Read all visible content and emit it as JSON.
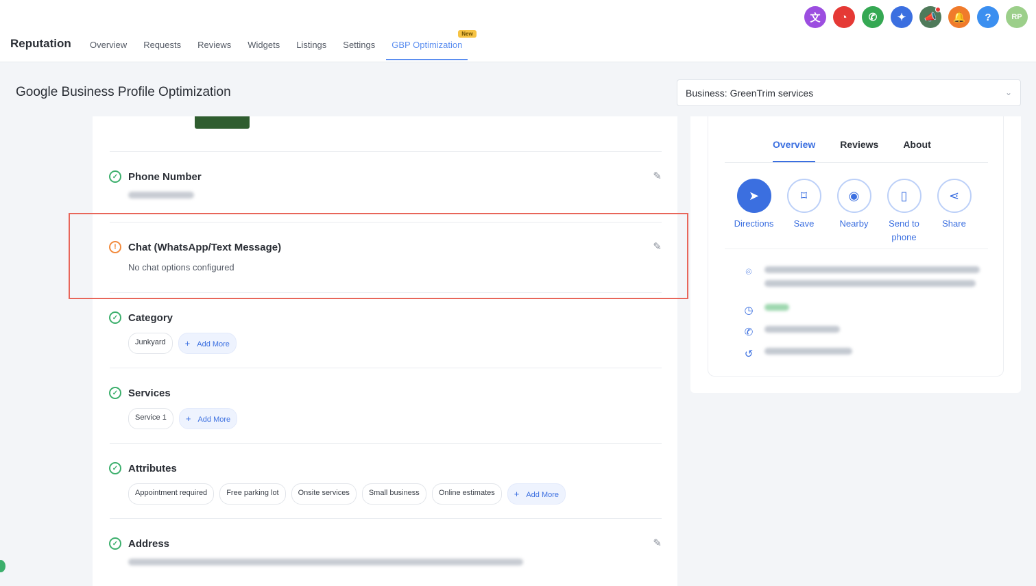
{
  "app": {
    "brand": "Reputation",
    "nav": [
      {
        "label": "Overview"
      },
      {
        "label": "Requests"
      },
      {
        "label": "Reviews"
      },
      {
        "label": "Widgets"
      },
      {
        "label": "Listings"
      },
      {
        "label": "Settings"
      },
      {
        "label": "GBP Optimization",
        "badge": "New",
        "active": true
      }
    ],
    "top_icons": [
      {
        "name": "translate-icon",
        "glyph": "文",
        "color": "#9c4ee0"
      },
      {
        "name": "speedometer-icon",
        "glyph": "◔",
        "color": "#e53935"
      },
      {
        "name": "phone-icon",
        "glyph": "✆",
        "color": "#35a853"
      },
      {
        "name": "magic-wand-icon",
        "glyph": "✦",
        "color": "#3b6fe0"
      },
      {
        "name": "megaphone-icon",
        "glyph": "📣",
        "color": "#4f7a5a",
        "dot": true
      },
      {
        "name": "bell-icon",
        "glyph": "🔔",
        "color": "#f07b2b"
      },
      {
        "name": "help-icon",
        "glyph": "?",
        "color": "#3b8ff0"
      },
      {
        "name": "user-avatar-icon",
        "glyph": "RP",
        "color": "#9ccf8a"
      }
    ]
  },
  "page": {
    "title": "Google Business Profile Optimization",
    "business_select": "Business: GreenTrim services"
  },
  "sections": {
    "phone": {
      "title": "Phone Number"
    },
    "chat": {
      "title": "Chat (WhatsApp/Text Message)",
      "subtitle": "No chat options configured"
    },
    "category": {
      "title": "Category",
      "chips": [
        "Junkyard"
      ],
      "add_label": "Add More"
    },
    "services": {
      "title": "Services",
      "chips": [
        "Service 1"
      ],
      "add_label": "Add More"
    },
    "attributes": {
      "title": "Attributes",
      "chips": [
        "Appointment required",
        "Free parking lot",
        "Onsite services",
        "Small business",
        "Online estimates"
      ],
      "add_label": "Add More"
    },
    "address": {
      "title": "Address"
    }
  },
  "preview": {
    "tabs": [
      "Overview",
      "Reviews",
      "About"
    ],
    "actions": [
      {
        "label": "Directions",
        "icon": "directions-icon",
        "glyph": "➤"
      },
      {
        "label": "Save",
        "icon": "bookmark-icon",
        "glyph": "⌑"
      },
      {
        "label": "Nearby",
        "icon": "nearby-icon",
        "glyph": "◉"
      },
      {
        "label": "Send to phone",
        "icon": "send-to-phone-icon",
        "glyph": "▯"
      },
      {
        "label": "Share",
        "icon": "share-icon",
        "glyph": "⋖"
      }
    ]
  },
  "colors": {
    "accent": "#3b6fe0",
    "success": "#3caf6c",
    "warning": "#f28a3c",
    "highlight_border": "#e8665a"
  }
}
